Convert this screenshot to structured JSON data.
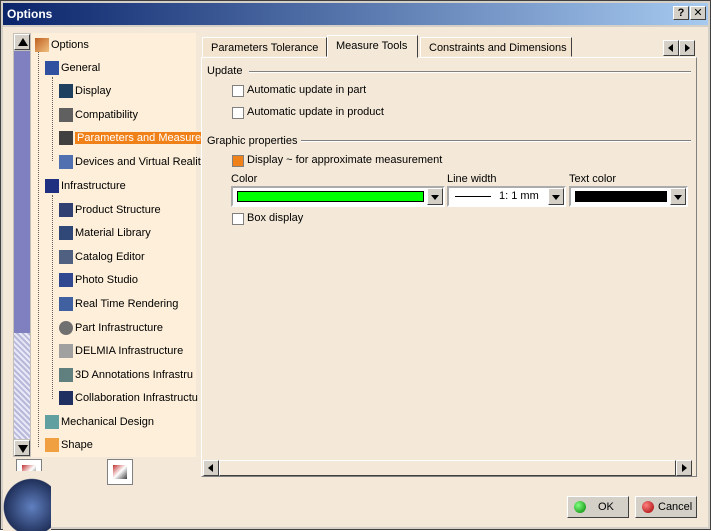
{
  "window": {
    "title": "Options",
    "help_glyph": "?",
    "close_glyph": "✕"
  },
  "tree": {
    "root": "Options",
    "items": [
      {
        "label": "General",
        "icon": "general-icon"
      },
      {
        "label": "Display",
        "icon": "display-icon"
      },
      {
        "label": "Compatibility",
        "icon": "compatibility-icon"
      },
      {
        "label": "Parameters and Measure",
        "icon": "parameters-measure-icon",
        "selected": true
      },
      {
        "label": "Devices and Virtual Realit",
        "icon": "devices-vr-icon"
      },
      {
        "label": "Infrastructure",
        "icon": "infrastructure-icon"
      },
      {
        "label": "Product Structure",
        "icon": "product-structure-icon"
      },
      {
        "label": "Material Library",
        "icon": "material-library-icon"
      },
      {
        "label": "Catalog Editor",
        "icon": "catalog-editor-icon"
      },
      {
        "label": "Photo Studio",
        "icon": "photo-studio-icon"
      },
      {
        "label": "Real Time Rendering",
        "icon": "rendering-icon"
      },
      {
        "label": "Part Infrastructure",
        "icon": "part-infrastructure-icon"
      },
      {
        "label": "DELMIA Infrastructure",
        "icon": "delmia-icon"
      },
      {
        "label": "3D Annotations Infrastru",
        "icon": "annotations-icon"
      },
      {
        "label": "Collaboration Infrastructu",
        "icon": "collaboration-icon"
      },
      {
        "label": "Mechanical Design",
        "icon": "mechanical-design-icon"
      },
      {
        "label": "Shape",
        "icon": "shape-icon"
      }
    ]
  },
  "tabs": [
    {
      "label": "Parameters Tolerance"
    },
    {
      "label": "Measure Tools",
      "active": true
    },
    {
      "label": "Constraints and Dimensions"
    }
  ],
  "update": {
    "title": "Update",
    "auto_part": {
      "label": "Automatic update in part",
      "checked": false
    },
    "auto_product": {
      "label": "Automatic update in product",
      "checked": false
    }
  },
  "graphic": {
    "title": "Graphic properties",
    "approx": {
      "label": "Display ~ for approximate measurement",
      "checked": true
    },
    "color_label": "Color",
    "color_value": "#00ff00",
    "linewidth_label": "Line width",
    "linewidth_value": "1: 1 mm",
    "textcolor_label": "Text color",
    "textcolor_value": "#000000",
    "box": {
      "label": "Box display",
      "checked": false
    }
  },
  "buttons": {
    "ok": "OK",
    "cancel": "Cancel"
  }
}
